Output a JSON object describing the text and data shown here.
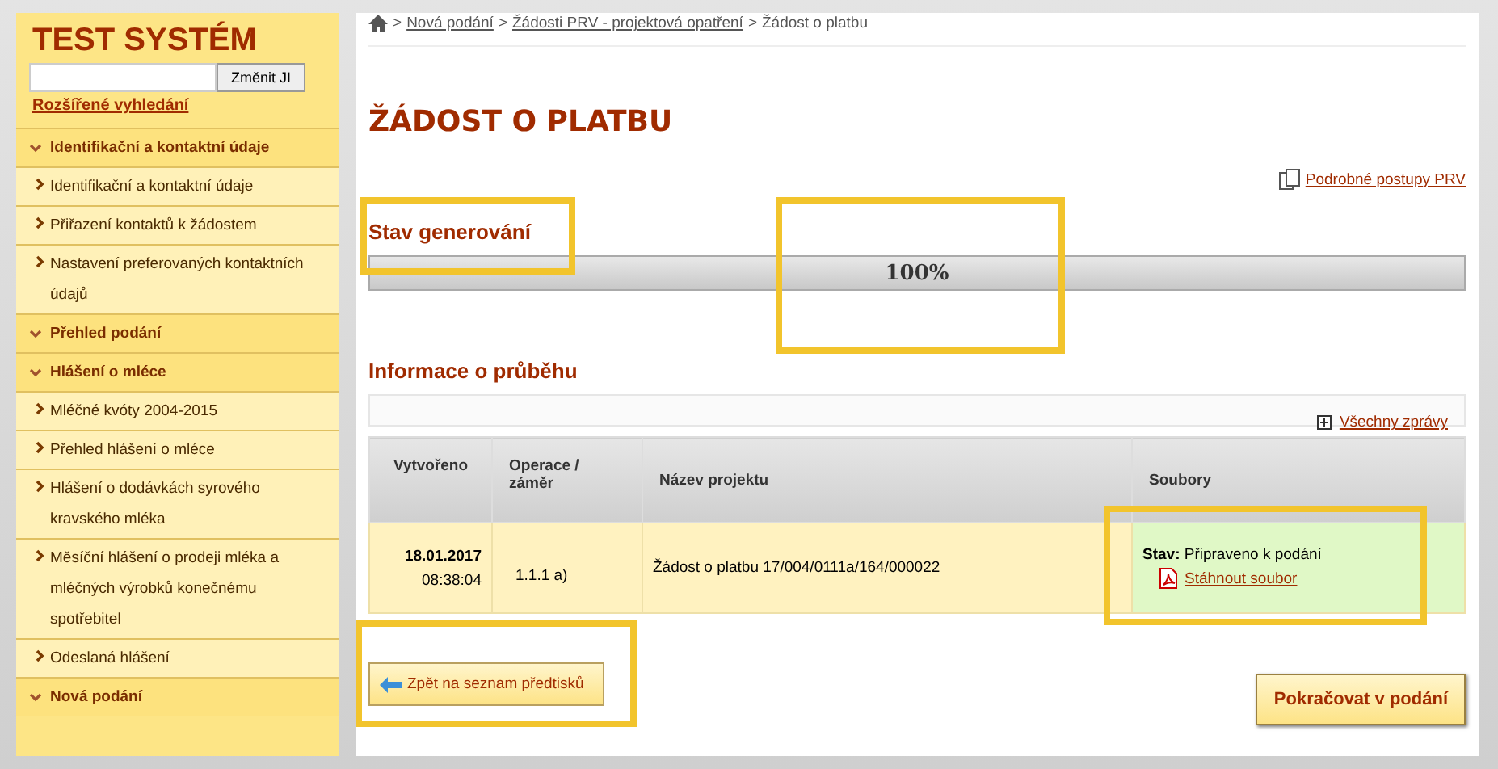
{
  "sidebar": {
    "title": "TEST SYSTÉM",
    "search": {
      "button": "Změnit JI"
    },
    "advanced_search": "Rozšířené vyhledání",
    "sections": [
      {
        "label": "Identifikační a kontaktní údaje",
        "children": [
          {
            "label": "Identifikační a kontaktní údaje"
          },
          {
            "label": "Přiřazení kontaktů k žádostem"
          },
          {
            "label": "Nastavení preferovaných kontaktních údajů"
          }
        ]
      },
      {
        "label": "Přehled podání"
      },
      {
        "label": "Hlášení o mléce",
        "children": [
          {
            "label": "Mléčné kvóty 2004-2015"
          },
          {
            "label": "Přehled hlášení o mléce"
          },
          {
            "label": "Hlášení o dodávkách syrového kravského mléka"
          },
          {
            "label": "Měsíční hlášení o prodeji mléka a mléčných výrobků konečnému spotřebitel"
          },
          {
            "label": "Odeslaná hlášení"
          }
        ]
      },
      {
        "label": "Nová podání"
      }
    ]
  },
  "breadcrumb": {
    "links": [
      "Nová podání",
      "Žádosti PRV - projektová opatření"
    ],
    "current": "Žádost o platbu",
    "separator": ">"
  },
  "page_title": "ŽÁDOST O PLATBU",
  "help_link": "Podrobné postupy PRV",
  "generation": {
    "heading": "Stav generování",
    "level": 1,
    "reading": "100%"
  },
  "progress_info": {
    "heading": "Informace o průběhu",
    "all_messages": "Všechny zprávy",
    "table": {
      "columns": [
        "Vytvořeno",
        "Operace / záměr",
        "Název projektu",
        "Soubory"
      ],
      "rows": [
        {
          "date": "18.01.2017",
          "time": "08:38:04",
          "operation": "1.1.1 a)",
          "project": "Žádost o platbu 17/004/0111a/164/000022",
          "status_label": "Stav:",
          "status": "Připraveno k podání",
          "download": "Stáhnout soubor"
        }
      ]
    }
  },
  "buttons": {
    "back": "Zpět na seznam předtisků",
    "continue": "Pokračovat v podání"
  }
}
